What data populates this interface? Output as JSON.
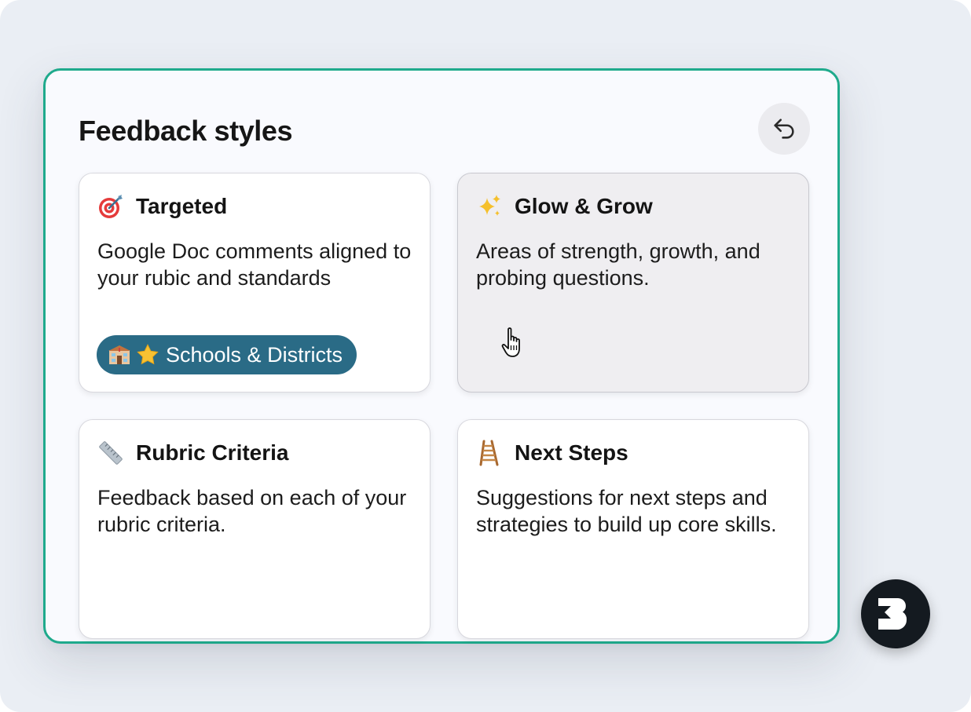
{
  "panel": {
    "title": "Feedback styles",
    "back_icon": "undo-arrow-icon"
  },
  "cards": [
    {
      "title": "Targeted",
      "icon": "target-icon",
      "description": "Google Doc comments aligned to your rubic and standards",
      "badge": {
        "label": "Schools & Districts",
        "icons": [
          "school-icon",
          "star-icon"
        ]
      }
    },
    {
      "title": "Glow & Grow",
      "icon": "sparkles-icon",
      "description": "Areas of strength, growth, and probing questions.",
      "state": "hovered"
    },
    {
      "title": "Rubric Criteria",
      "icon": "ruler-icon",
      "description": "Feedback based on each of your rubric criteria."
    },
    {
      "title": "Next Steps",
      "icon": "ladder-icon",
      "description": "Suggestions for next steps and strategies to build up core skills."
    }
  ],
  "brand": {
    "icon": "brand-logo-icon"
  },
  "colors": {
    "panel_border": "#1faa8c",
    "badge_bg": "#2a6b86",
    "background": "#eaeef4",
    "hover_card_bg": "#efeef1"
  }
}
